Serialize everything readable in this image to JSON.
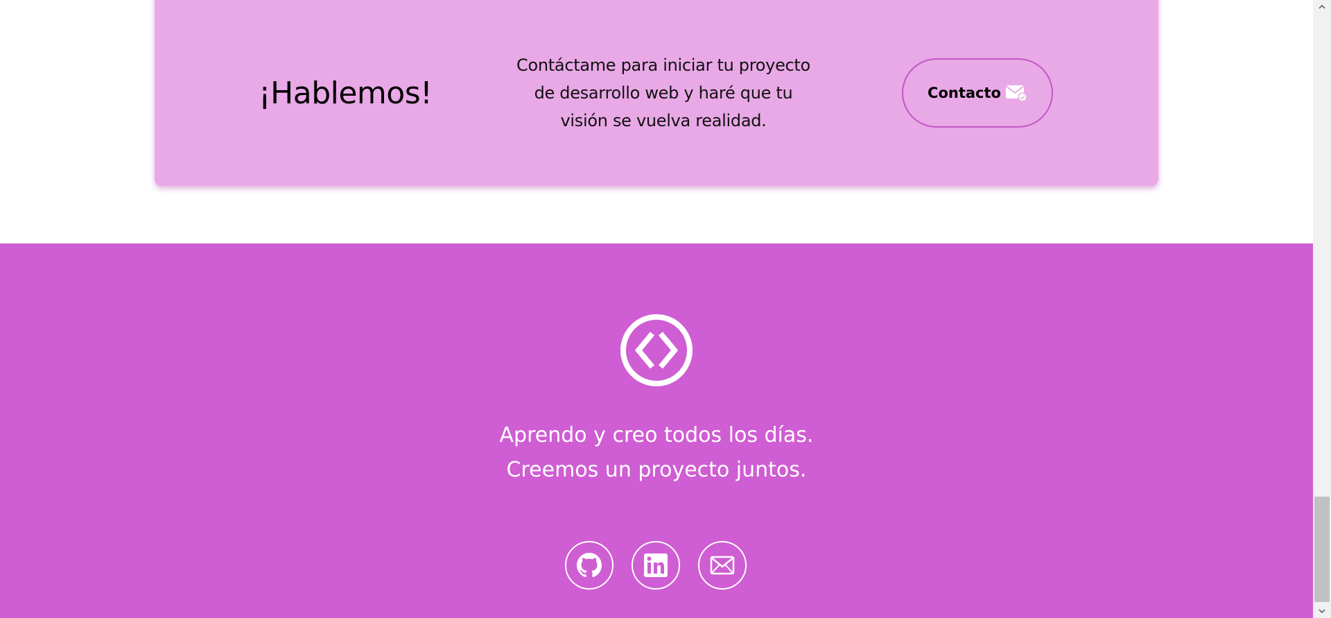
{
  "cta": {
    "title": "¡Hablemos!",
    "text": "Contáctame para iniciar tu proyecto de desarrollo web y haré que tu visión se vuelva realidad.",
    "button_label": "Contacto",
    "button_icon": "mail-check-icon"
  },
  "footer": {
    "logo_icon": "code-brackets-circle-icon",
    "tagline_line1": "Aprendo y creo todos los días.",
    "tagline_line2": "Creemos un proyecto juntos.",
    "social": [
      {
        "icon": "github-icon"
      },
      {
        "icon": "linkedin-icon"
      },
      {
        "icon": "mail-icon"
      }
    ]
  },
  "colors": {
    "cta_background": "#e9a8e6",
    "cta_button_border": "#c157c6",
    "footer_background": "#cf5dd3",
    "footer_text": "#ffffff"
  },
  "scrollbar": {
    "up_icon": "chevron-up-icon",
    "down_icon": "chevron-down-icon"
  }
}
